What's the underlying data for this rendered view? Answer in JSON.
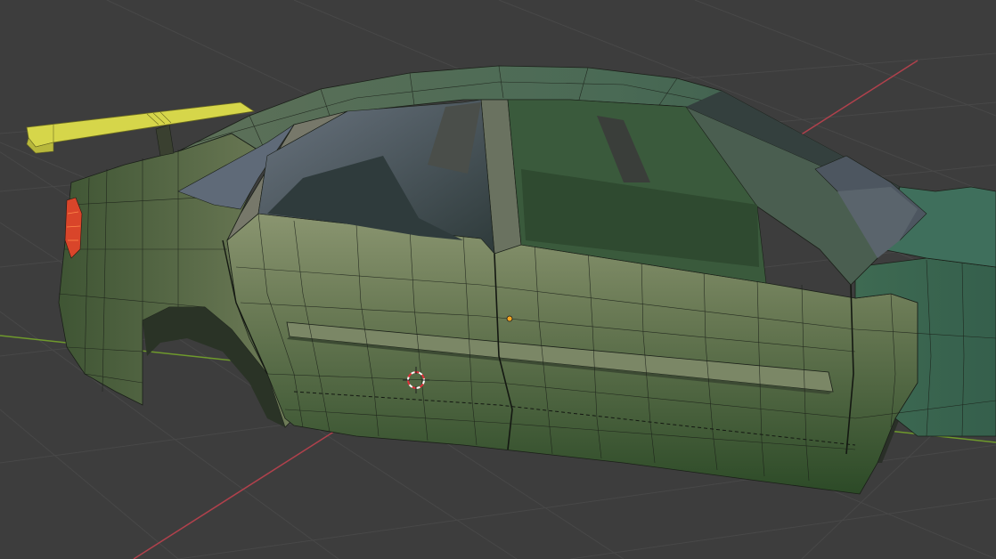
{
  "viewport": {
    "background": "#3d3d3d",
    "grid_color": "#4a4a4a",
    "x_axis_color": "#b0414c",
    "y_axis_color": "#6f9a2c"
  },
  "model": {
    "body_color": "#3d5a35",
    "body_highlight": "#7a8a5e",
    "roof_color": "#4f6b57",
    "wireframe_color": "#1a1f18",
    "selected_part_color": "#d6d64a",
    "taillight_color": "#e04a2a",
    "interior_color": "#5a6470"
  },
  "overlays": {
    "cursor_3d_icon": "3d-cursor-icon",
    "origin_icon": "object-origin-icon",
    "origin_color": "#f5a623"
  }
}
